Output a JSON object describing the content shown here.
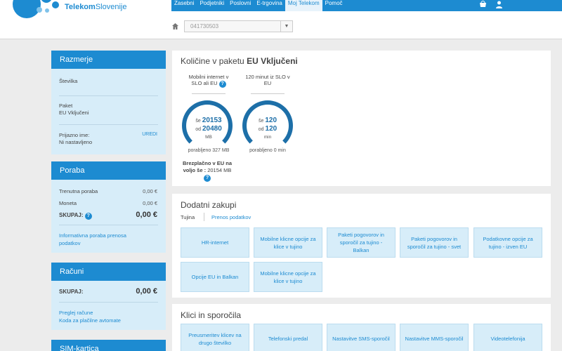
{
  "header": {
    "brand_a": "Telekom",
    "brand_b": "Slovenije",
    "nav": [
      "Zasebni",
      "Podjetniki",
      "Poslovni",
      "E-trgovina",
      "Moj Telekom",
      "Pomoč"
    ],
    "active_nav": "Moj Telekom",
    "number_select": "041730503",
    "colors": {
      "brand": "#1d8bd1"
    }
  },
  "razmerje": {
    "title": "Razmerje",
    "stevilka_label": "Številka",
    "paket_label": "Paket",
    "paket_value": "EU Vključeni",
    "ime_label": "Prijazno ime:",
    "ime_value": "Ni nastavljeno",
    "uredi": "UREDI"
  },
  "poraba": {
    "title": "Poraba",
    "trenutna_label": "Trenutna poraba",
    "trenutna_value": "0,00 €",
    "moneta_label": "Moneta",
    "moneta_value": "0,00 €",
    "skupaj_label": "SKUPAJ:",
    "skupaj_value": "0,00 €",
    "link_line1": "Informativna poraba prenosa",
    "link_line2": "podatkov"
  },
  "racuni": {
    "title": "Računi",
    "skupaj_label": "SKUPAJ:",
    "skupaj_value": "0,00 €",
    "link1": "Preglej račune",
    "link2": "Koda za plačilne avtomate"
  },
  "sim": {
    "title": "SIM-kartica"
  },
  "kolicine": {
    "title_prefix": "Količine v paketu",
    "title_package": "EU Vključeni",
    "internet": {
      "label_line1": "Mobilni internet v",
      "label_line2": "SLO ali EU",
      "se_label": "še",
      "se_value": "20153",
      "od_label": "od",
      "od_value": "20480",
      "unit": "MB",
      "used": "porabljeno 327 MB"
    },
    "minutes": {
      "label_line1": "120 minut iz SLO v",
      "label_line2": "EU",
      "se_label": "še",
      "se_value": "120",
      "od_label": "od",
      "od_value": "120",
      "unit": "min",
      "used": "porabljeno 0 min"
    },
    "free_line1": "Brezplačno v EU na",
    "free_line2_bold": "voljo še :",
    "free_line2_value": "20154 MB"
  },
  "dodatni": {
    "title": "Dodatni zakupi",
    "tabs": [
      "Tujina",
      "Prenos podatkov"
    ],
    "tiles": [
      "HR-internet",
      "Mobilne klicne opcije za klice v tujino",
      "Paketi pogovorov in sporočil za tujino - Balkan",
      "Paketi pogovorov in sporočil za tujino - svet",
      "Podatkovne opcije za tujino - izven EU",
      "Opcije EU in Balkan",
      "Mobilne klicne opcije za klice v tujino"
    ]
  },
  "klici": {
    "title": "Klici in sporočila",
    "tiles": [
      "Preusmeritev klicev na drugo številko",
      "Telefonski predal",
      "Nastavitve SMS-sporočil",
      "Nastavitve MMS-sporočil",
      "Videotelefonija"
    ]
  }
}
